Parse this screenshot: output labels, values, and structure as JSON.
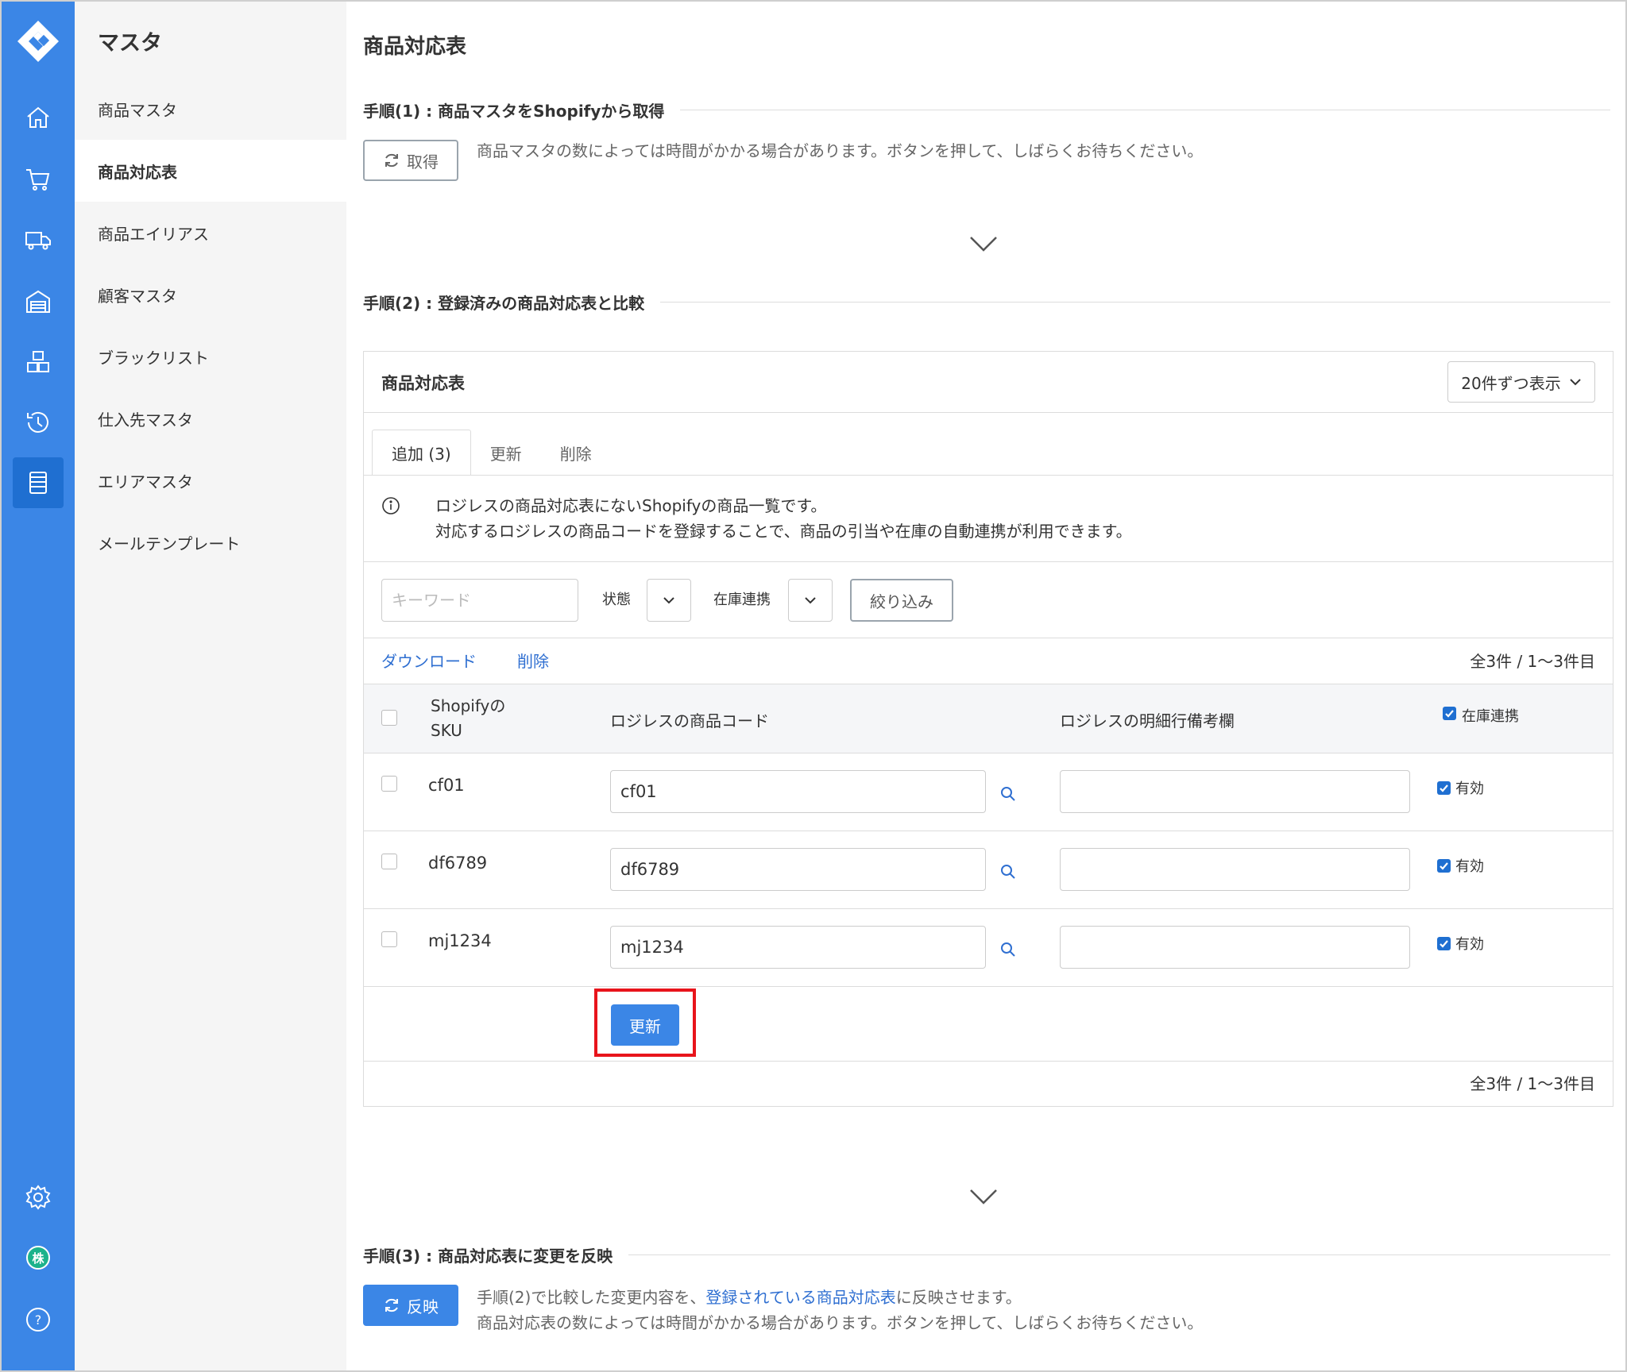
{
  "sidebar": {
    "title": "マスタ",
    "items": [
      {
        "label": "商品マスタ",
        "active": false
      },
      {
        "label": "商品対応表",
        "active": true
      },
      {
        "label": "商品エイリアス",
        "active": false
      },
      {
        "label": "顧客マスタ",
        "active": false
      },
      {
        "label": "ブラックリスト",
        "active": false
      },
      {
        "label": "仕入先マスタ",
        "active": false
      },
      {
        "label": "エリアマスタ",
        "active": false
      },
      {
        "label": "メールテンプレート",
        "active": false
      }
    ],
    "rail_icons": [
      "home-icon",
      "cart-icon",
      "truck-icon",
      "warehouse-icon",
      "boxes-icon",
      "history-icon",
      "list-icon",
      "gear-icon",
      "company-icon",
      "help-icon"
    ],
    "company_badge": "株"
  },
  "page": {
    "title": "商品対応表"
  },
  "step1": {
    "heading": "手順(1) : 商品マスタをShopifyから取得",
    "button": "取得",
    "note": "商品マスタの数によっては時間がかかる場合があります。ボタンを押して、しばらくお待ちください。"
  },
  "step2": {
    "heading": "手順(2) : 登録済みの商品対応表と比較"
  },
  "card": {
    "title": "商品対応表",
    "per_page": "20件ずつ表示",
    "tabs": [
      {
        "label": "追加 (3)",
        "active": true
      },
      {
        "label": "更新",
        "active": false
      },
      {
        "label": "削除",
        "active": false
      }
    ],
    "info_line1": "ロジレスの商品対応表にないShopifyの商品一覧です。",
    "info_line2": "対応するロジレスの商品コードを登録することで、商品の引当や在庫の自動連携が利用できます。",
    "filter": {
      "keyword_placeholder": "キーワード",
      "status_label": "状態",
      "stock_label": "在庫連携",
      "button": "絞り込み"
    },
    "actions": {
      "download": "ダウンロード",
      "delete": "削除"
    },
    "count_top": "全3件 / 1〜3件目",
    "count_bottom": "全3件 / 1〜3件目",
    "columns": {
      "sku_line1": "Shopifyの",
      "sku_line2": "SKU",
      "code": "ロジレスの商品コード",
      "memo": "ロジレスの明細行備考欄",
      "stock": "在庫連携"
    },
    "rows": [
      {
        "sku": "cf01",
        "code": "cf01",
        "memo": "",
        "stock_label": "有効"
      },
      {
        "sku": "df6789",
        "code": "df6789",
        "memo": "",
        "stock_label": "有効"
      },
      {
        "sku": "mj1234",
        "code": "mj1234",
        "memo": "",
        "stock_label": "有効"
      }
    ],
    "update_button": "更新"
  },
  "step3": {
    "heading": "手順(3) : 商品対応表に変更を反映",
    "button": "反映",
    "note_prefix": "手順(2)で比較した変更内容を、",
    "note_link": "登録されている商品対応表",
    "note_suffix": "に反映させます。",
    "note_line2": "商品対応表の数によっては時間がかかる場合があります。ボタンを押して、しばらくお待ちください。"
  },
  "colors": {
    "accent": "#3b86e6",
    "rail": "#3b86e6",
    "highlight": "#e8141b",
    "link": "#2f6fd1"
  }
}
